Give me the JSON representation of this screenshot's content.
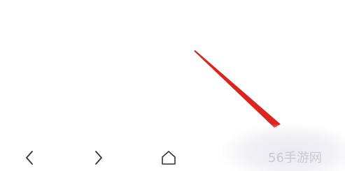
{
  "annotation": {
    "arrow_color": "#d9251d"
  },
  "nav_bar": {
    "back_icon": "chevron-left-icon",
    "forward_icon": "chevron-right-icon",
    "home_icon": "home-icon",
    "icon_color": "#333333"
  },
  "watermark": {
    "text": "56手游网"
  }
}
